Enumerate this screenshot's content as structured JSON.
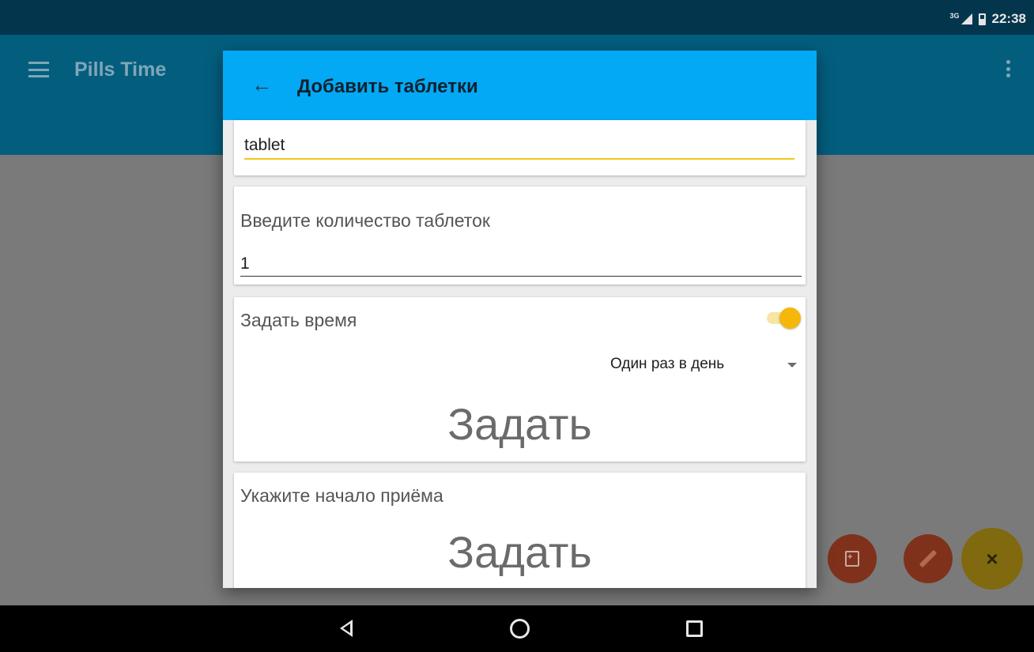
{
  "status_bar": {
    "network_type": "3G",
    "time": "22:38"
  },
  "app_bar": {
    "title": "Pills Time",
    "menu_icon": "menu-icon",
    "overflow_icon": "more-vert-icon"
  },
  "dialog": {
    "title": "Добавить таблетки",
    "back_icon": "arrow-back-icon",
    "name_field": {
      "value": "tablet"
    },
    "quantity": {
      "label": "Введите количество таблеток",
      "value": "1"
    },
    "set_time": {
      "label": "Задать время",
      "toggle_on": true,
      "frequency": "Один раз в день",
      "set_button": "Задать"
    },
    "start": {
      "label": "Укажите начало приёма",
      "set_button": "Задать"
    }
  },
  "fabs": {
    "main_icon": "close-icon",
    "main_label": "×",
    "secondary": [
      "add-document-icon",
      "syringe-icon"
    ]
  },
  "nav_bar": {
    "buttons": [
      "back-icon",
      "home-icon",
      "recents-icon"
    ]
  },
  "colors": {
    "dialog_header": "#03a9f4",
    "accent": "#f5b80a",
    "app_bar": "#035e7e"
  }
}
